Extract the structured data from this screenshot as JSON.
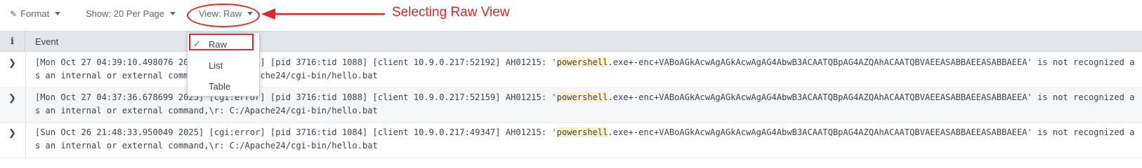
{
  "toolbar": {
    "format_label": "Format",
    "show_label": "Show: 20 Per Page",
    "view_label": "View: Raw"
  },
  "annotation": {
    "text": "Selecting Raw View",
    "color": "#e8242a"
  },
  "table": {
    "info_header": "i",
    "event_header": "Event",
    "rows": [
      {
        "before": "[Mon Oct 27 04:39:10.498076 2025] [cgi:error] [pid 3716:tid 1088] [client 10.9.0.217:52192] AH01215: '",
        "highlight": "powershell",
        "after": ".exe+-enc+VABoAGkAcwAgAGkAcwAgAG4AbwB3ACAATQBpAG4AZQAhACAATQBVAEEASABBAEEASABBAEEA' is not recognized as an internal or external command,\\r: C:/Apache24/cgi-bin/hello.bat"
      },
      {
        "before": "[Mon Oct 27 04:37:36.678699 2025] [cgi:error] [pid 3716:tid 1088] [client 10.9.0.217:52159] AH01215: '",
        "highlight": "powershell",
        "after": ".exe+-enc+VABoAGkAcwAgAGkAcwAgAG4AbwB3ACAATQBpAG4AZQAhACAATQBVAEEASABBAEEASABBAEEA' is not recognized as an internal or external command,\\r: C:/Apache24/cgi-bin/hello.bat"
      },
      {
        "before": "[Sun Oct 26 21:48:33.950049 2025] [cgi:error] [pid 3716:tid 1084] [client 10.9.0.217:49347] AH01215: '",
        "highlight": "powershell",
        "after": ".exe+-enc+VABoAGkAcwAgAGkAcwAgAG4AbwB3ACAATQBpAG4AZQAhACAATQBVAEEASABBAEEASABBAEEA' is not recognized as an internal or external command,\\r: C:/Apache24/cgi-bin/hello.bat"
      }
    ]
  },
  "view_menu": {
    "items": [
      {
        "label": "Raw",
        "selected": true
      },
      {
        "label": "List",
        "selected": false
      },
      {
        "label": "Table",
        "selected": false
      }
    ]
  },
  "icons": {
    "format": "paintbrush-icon",
    "caret": "caret-down-icon",
    "expand": "chevron-right-icon",
    "check": "checkmark-icon"
  }
}
